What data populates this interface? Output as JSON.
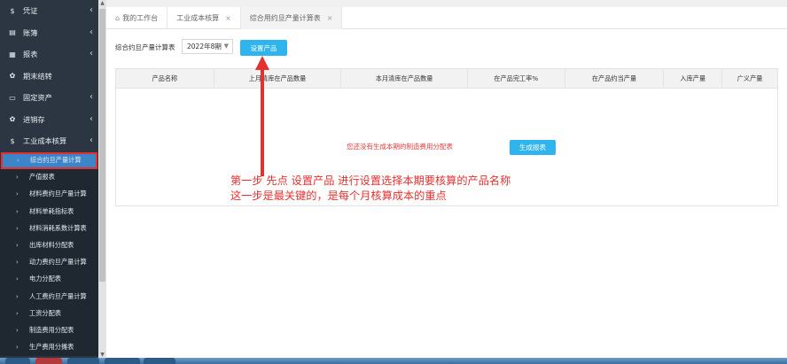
{
  "sidebar": {
    "groups": [
      {
        "icon": "$",
        "icon_name": "dollar-icon",
        "label": "凭证",
        "chevron": "‹"
      },
      {
        "icon": "▤",
        "icon_name": "ledger-icon",
        "label": "账簿",
        "chevron": "‹"
      },
      {
        "icon": "▦",
        "icon_name": "report-icon",
        "label": "报表",
        "chevron": "‹"
      },
      {
        "icon": "✿",
        "icon_name": "period-close-icon",
        "label": "期末结转",
        "chevron": ""
      },
      {
        "icon": "▭",
        "icon_name": "fixed-asset-icon",
        "label": "固定资产",
        "chevron": "‹"
      },
      {
        "icon": "✿",
        "icon_name": "inventory-icon",
        "label": "进销存",
        "chevron": "‹"
      },
      {
        "icon": "$",
        "icon_name": "cost-accounting-icon",
        "label": "工业成本核算",
        "chevron": "‹"
      }
    ],
    "sub_items": [
      {
        "label": "综合约旦产量计算",
        "selected": true
      },
      {
        "label": "产值报表"
      },
      {
        "label": "材料费约旦产量计算"
      },
      {
        "label": "材料单耗指标表"
      },
      {
        "label": "材料消耗系数计算表"
      },
      {
        "label": "出库材料分配表"
      },
      {
        "label": "动力费约旦产量计算"
      },
      {
        "label": "电力分配表"
      },
      {
        "label": "人工费约旦产量计算"
      },
      {
        "label": "工资分配表"
      },
      {
        "label": "制造费用分配表"
      },
      {
        "label": "生产费用分摊表"
      }
    ],
    "sub_arrow": "›"
  },
  "tabs": [
    {
      "label": "我的工作台",
      "home_icon": "⌂",
      "closable": false
    },
    {
      "label": "工业成本核算",
      "closable": true
    },
    {
      "label": "综合用约旦产量计算表",
      "closable": true,
      "active": true
    }
  ],
  "tab_close": "×",
  "toolbar": {
    "label": "综合约旦产量计算表",
    "period": "2022年8期",
    "set_product_button": "设置产品"
  },
  "table": {
    "columns": [
      "产品名称",
      "上月清库在产品数量",
      "本月清库在产品数量",
      "在产品完工率%",
      "在产品约当产量",
      "入库产量",
      "广义产量"
    ]
  },
  "empty_message": "您还没有生成本期的制造费用分配表",
  "generate_button": "生成报表",
  "annotation": {
    "line1": "第一步  先点 设置产品  进行设置选择本期要核算的产品名称",
    "line2": "这一步是最关键的，是每个月核算成本的重点"
  },
  "colors": {
    "sidebar_bg": "#2b3642",
    "selected_bg": "#3b85c8",
    "button_blue": "#2fb4ee",
    "annotation_red": "#e53030"
  }
}
